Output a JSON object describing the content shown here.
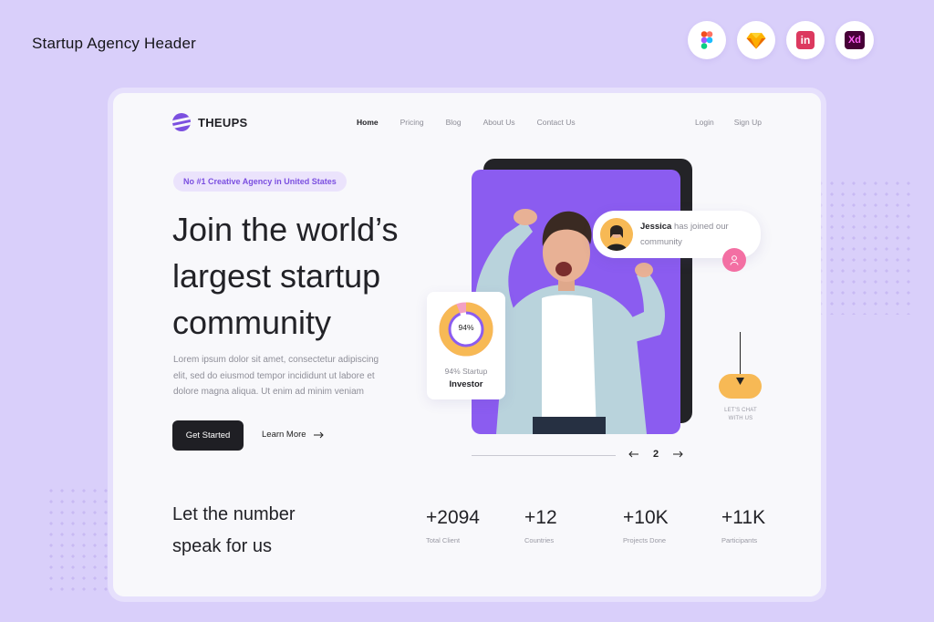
{
  "frame_title": "Startup Agency Header",
  "tools": [
    {
      "icon": "figma-icon"
    },
    {
      "icon": "sketch-icon"
    },
    {
      "icon": "invision-icon",
      "label": "in"
    },
    {
      "icon": "adobe-xd-icon",
      "label": "Xd"
    }
  ],
  "nav": {
    "logo": "THEUPS",
    "menu": [
      "Home",
      "Pricing",
      "Blog",
      "About Us",
      "Contact Us"
    ],
    "active": "Home",
    "login": "Login",
    "signup": "Sign Up"
  },
  "hero": {
    "pill": "No #1 Creative Agency in United States",
    "headline": "Join the world’s largest startup community",
    "body": "Lorem ipsum dolor sit amet, consectetur adipiscing elit, sed do eiusmod tempor incididunt ut labore et dolore magna aliqua. Ut enim ad minim veniam",
    "cta_primary": "Get Started",
    "cta_secondary": "Learn More"
  },
  "notification": {
    "name": "Jessica",
    "message": "has joined our community"
  },
  "stat_card": {
    "percent_label": "94%",
    "percent": 94,
    "line1": "94% Startup",
    "line2": "Investor"
  },
  "chat": {
    "label": "LET'S CHAT WITH US"
  },
  "pager": {
    "page": "2"
  },
  "numbers": {
    "tagline_1": "Let the number",
    "tagline_2": "speak for us",
    "items": [
      {
        "value": "+2094",
        "caption": "Total Client"
      },
      {
        "value": "+12",
        "caption": "Countries"
      },
      {
        "value": "+10K",
        "caption": "Projects Done"
      },
      {
        "value": "+11K",
        "caption": "Participants"
      }
    ]
  },
  "colors": {
    "accent": "#8b5cf0",
    "dark": "#1f1f24",
    "orange": "#f7b955",
    "pink": "#f36fa3",
    "background": "#d9cffa"
  }
}
